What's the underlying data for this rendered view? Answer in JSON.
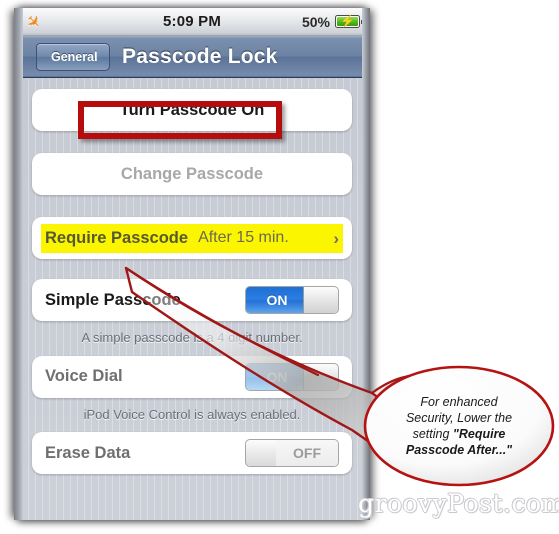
{
  "status_bar": {
    "airplane_icon": "airplane-mode-icon",
    "time": "5:09 PM",
    "battery_percent": "50%",
    "battery_icon": "battery-charging-icon",
    "bolt_glyph": "⚡"
  },
  "nav_bar": {
    "back_label": "General",
    "title": "Passcode Lock"
  },
  "settings": {
    "turn_passcode": {
      "label": "Turn Passcode On",
      "state": "enabled"
    },
    "change_passcode": {
      "label": "Change Passcode",
      "state": "disabled"
    },
    "require_passcode": {
      "label": "Require Passcode",
      "value": "After 15 min.",
      "chevron": "›",
      "highlight_color": "#fbf500"
    },
    "simple_passcode": {
      "label": "Simple Passcode",
      "toggle": "ON",
      "toggle_color": "#2472d6"
    },
    "simple_passcode_footnote": "A simple passcode is a 4 digit number.",
    "voice_dial": {
      "label": "Voice Dial",
      "toggle": "ON",
      "toggle_state": "disabled"
    },
    "voice_dial_footnote": "iPod Voice Control is always enabled.",
    "erase_data": {
      "label": "Erase Data",
      "toggle": "OFF"
    }
  },
  "annotations": {
    "highlight_box_color": "#b50d0d",
    "arrow_outline_color": "#a01717",
    "callout": {
      "line1": "For enhanced",
      "line2": "Security, Lower the",
      "line3_plain": "setting ",
      "line3_bold": "\"Require",
      "line4_bold": "Passcode After...\""
    }
  },
  "watermark": {
    "text": "groovyPost.com"
  }
}
